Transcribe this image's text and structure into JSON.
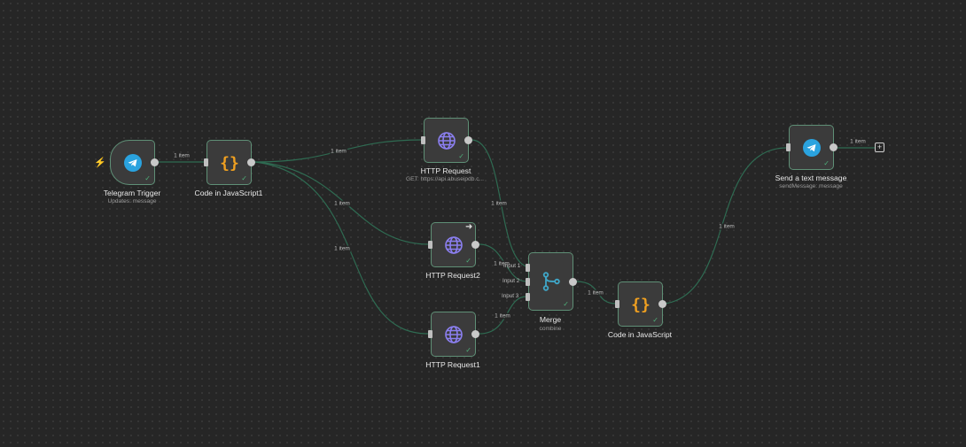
{
  "nodes": {
    "telegram_trigger": {
      "title": "Telegram Trigger",
      "subtitle": "Updates: message"
    },
    "code_js1": {
      "title": "Code in JavaScript1"
    },
    "http_request": {
      "title": "HTTP Request",
      "subtitle": "GET: https://api.abuseipdb.c..."
    },
    "http_request2": {
      "title": "HTTP Request2"
    },
    "http_request1": {
      "title": "HTTP Request1"
    },
    "merge": {
      "title": "Merge",
      "subtitle": "combine",
      "inputs": [
        "Input 1",
        "Input 2",
        "Input 3"
      ]
    },
    "code_js": {
      "title": "Code in JavaScript"
    },
    "send_message": {
      "title": "Send a text message",
      "subtitle": "sendMessage: message"
    }
  },
  "edge_labels": {
    "trigger_to_code1": "1 item",
    "code1_to_http": "1 item",
    "code1_to_http2": "1 item",
    "code1_to_http1": "1 item",
    "http_to_merge": "1 item",
    "http2_to_merge": "1 item",
    "http1_to_merge": "1 item",
    "merge_to_code": "1 item",
    "code_to_send": "1 item",
    "send_out": "1 item"
  },
  "colors": {
    "edge": "#2f6b52",
    "node_border": "#5f8f76",
    "telegram": "#2aa3df",
    "code": "#f0a020",
    "http": "#8b7ff0",
    "merge": "#3fa7c8",
    "success": "#4fb07a",
    "trigger": "#e2544b"
  },
  "icons": {
    "telegram": "telegram-icon",
    "code": "code-braces-icon",
    "http": "globe-icon",
    "merge": "merge-icon",
    "trigger": "lightning-icon",
    "success": "check-icon",
    "add": "plus-icon",
    "execute": "arrow-right-icon"
  }
}
